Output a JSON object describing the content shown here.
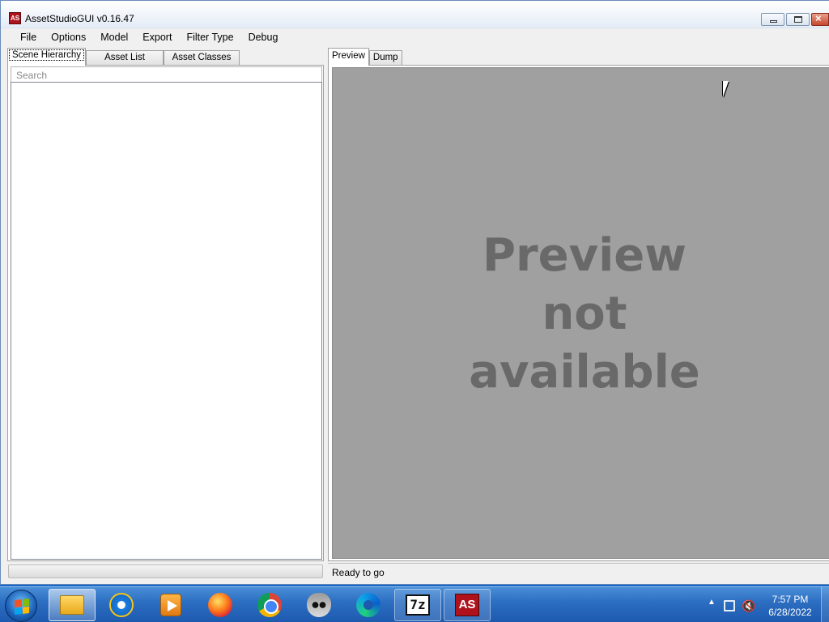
{
  "window": {
    "title": "AssetStudioGUI v0.16.47",
    "app_icon_text": "AS"
  },
  "menu": {
    "items": [
      "File",
      "Options",
      "Model",
      "Export",
      "Filter Type",
      "Debug"
    ]
  },
  "left_panel": {
    "tabs": [
      "Scene Hierarchy",
      "Asset List",
      "Asset Classes"
    ],
    "active_tab": "Scene Hierarchy",
    "search_placeholder": "Search"
  },
  "right_panel": {
    "tabs": [
      "Preview",
      "Dump"
    ],
    "active_tab": "Preview",
    "preview_message_lines": [
      "Preview",
      "not",
      "available"
    ],
    "status_text": "Ready to go"
  },
  "taskbar": {
    "items": [
      {
        "name": "windows-explorer",
        "icon": "folder-icon",
        "state": "active"
      },
      {
        "name": "internet-explorer",
        "icon": "ie-icon",
        "state": "pinned"
      },
      {
        "name": "media-player",
        "icon": "media-player-icon",
        "state": "pinned"
      },
      {
        "name": "firefox",
        "icon": "firefox-icon",
        "state": "pinned"
      },
      {
        "name": "chrome",
        "icon": "chrome-icon",
        "state": "pinned"
      },
      {
        "name": "raccoon-app",
        "icon": "raccoon-icon",
        "state": "pinned"
      },
      {
        "name": "edge",
        "icon": "edge-icon",
        "state": "pinned"
      },
      {
        "name": "7zip",
        "icon": "7zip-icon",
        "label": "7z",
        "state": "open"
      },
      {
        "name": "assetstudio",
        "icon": "assetstudio-icon",
        "label": "AS",
        "state": "open"
      }
    ],
    "clock_time": "7:57 PM",
    "clock_date": "6/28/2022"
  },
  "colors": {
    "preview_bg": "#a0a0a0",
    "preview_text": "#696969",
    "app_icon_red": "#b0121c",
    "taskbar_blue": "#1d5aaf"
  }
}
